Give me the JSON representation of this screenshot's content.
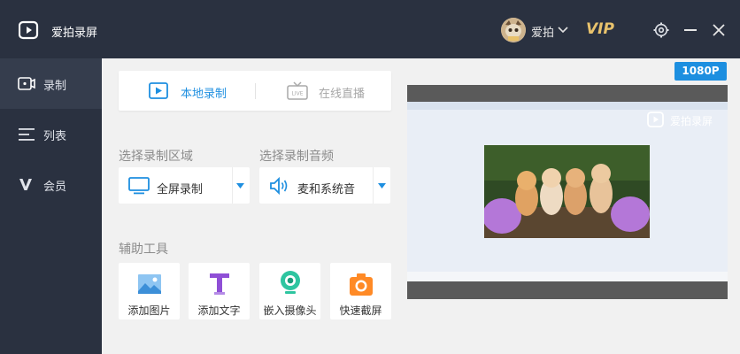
{
  "app": {
    "title": "爱拍录屏"
  },
  "user": {
    "name": "爱拍",
    "vip_label": "VIP"
  },
  "colors": {
    "accent": "#1d8fe0",
    "sidebar_bg": "#2a3140",
    "vip": "#e8c26c"
  },
  "sidebar": {
    "items": [
      {
        "label": "录制",
        "icon": "camera-record-icon",
        "active": true
      },
      {
        "label": "列表",
        "icon": "list-icon",
        "active": false
      },
      {
        "label": "会员",
        "icon": "vip-v-icon",
        "active": false
      }
    ]
  },
  "modes": {
    "local": {
      "label": "本地录制",
      "active": true
    },
    "live": {
      "label": "在线直播",
      "active": false
    }
  },
  "region": {
    "section_label": "选择录制区域",
    "selected": "全屏录制"
  },
  "audio": {
    "section_label": "选择录制音频",
    "selected": "麦和系统音"
  },
  "tools": {
    "section_label": "辅助工具",
    "items": [
      {
        "label": "添加图片",
        "icon": "image-icon"
      },
      {
        "label": "添加文字",
        "icon": "text-t-icon"
      },
      {
        "label": "嵌入摄像头",
        "icon": "webcam-icon"
      },
      {
        "label": "快速截屏",
        "icon": "screenshot-camera-icon"
      }
    ]
  },
  "preview": {
    "resolution": "1080P",
    "watermark": "爱拍录屏"
  }
}
